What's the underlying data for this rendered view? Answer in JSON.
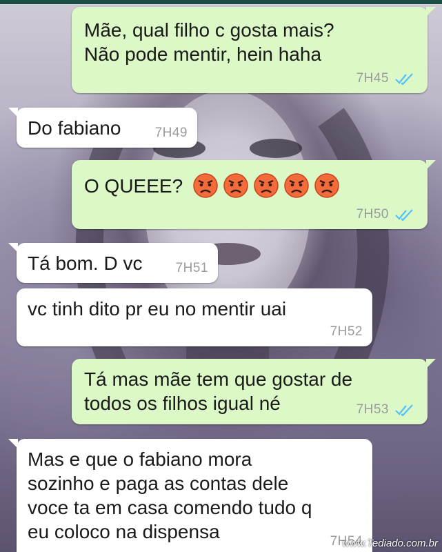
{
  "messages": [
    {
      "text": "Mãe,  qual filho c gosta mais?\nNão pode mentir,  hein haha",
      "time": "7H45"
    },
    {
      "text": "Do fabiano",
      "time": "7H49"
    },
    {
      "text": "O QUEEE?",
      "time": "7H50",
      "emojis": [
        "angry-face-emoji",
        "angry-face-emoji",
        "angry-face-emoji",
        "angry-face-emoji",
        "angry-face-emoji"
      ]
    },
    {
      "text": "Tá bom. D vc",
      "time": "7H51"
    },
    {
      "text": "vc tinh dito  pr eu no mentir uai",
      "time": "7H52"
    },
    {
      "text": "Tá mas mãe tem que gostar de\ntodos os filhos igual né",
      "time": "7H53"
    },
    {
      "text": "Mas e que o fabiano mora\nsozinho e paga as contas dele\nvoce ta em casa comendo tudo q\neu coloco na dispensa",
      "time": "7H54"
    }
  ],
  "read_receipt_icon": "double-check-icon",
  "colors": {
    "outgoing": "#dcf8c6",
    "incoming": "#ffffff",
    "read_tick": "#4fc3f7",
    "header": "#1e4f46"
  },
  "watermark": "www.Tediado.com.br"
}
